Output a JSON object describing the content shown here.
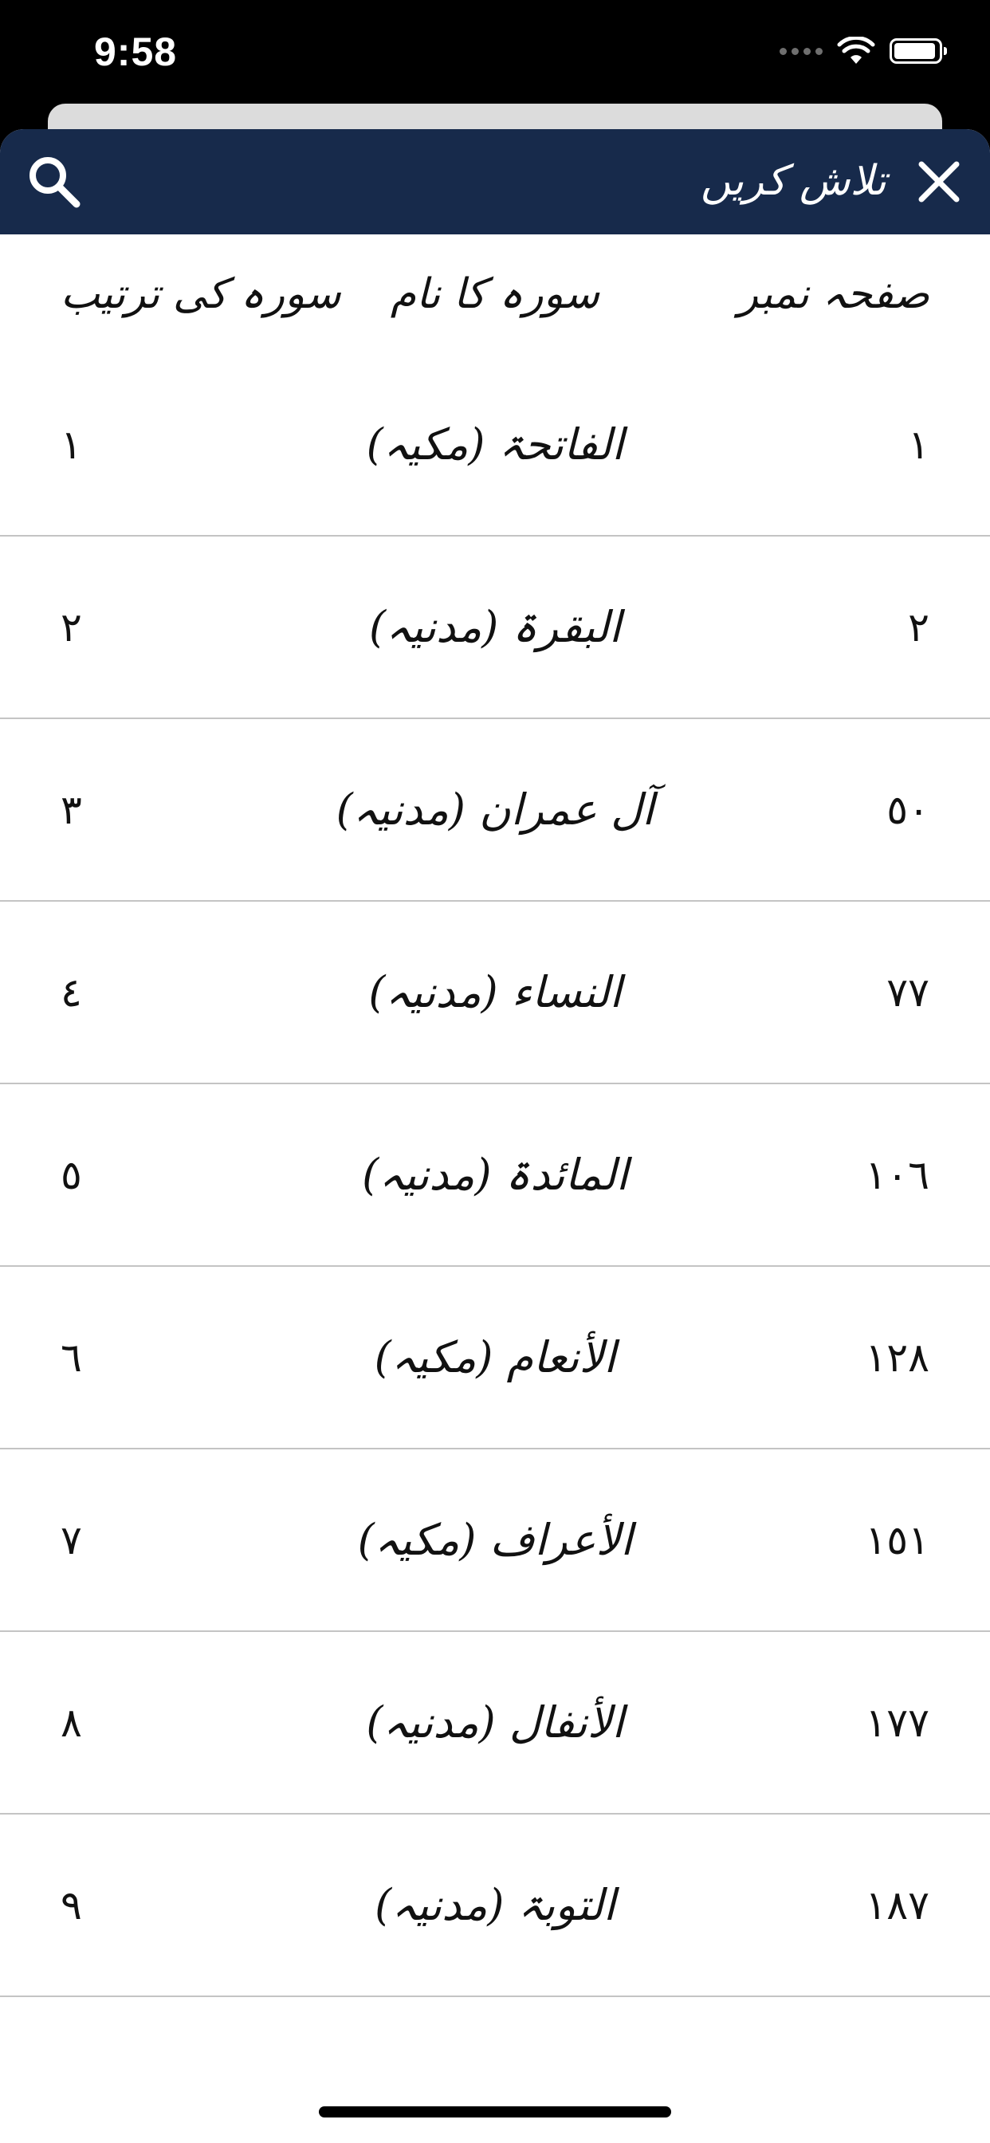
{
  "status_bar": {
    "time": "9:58",
    "battery_level": 0.95
  },
  "nav": {
    "title": "تلاش کریں",
    "search_icon": "search-icon",
    "close_icon": "close-icon",
    "bar_color": "#172a4b"
  },
  "table": {
    "headers": {
      "page": "صفحہ نمبر",
      "name": "سورہ کا نام",
      "order": "سورہ کی ترتیب"
    },
    "rows": [
      {
        "page": "١",
        "name": "الفاتحۃ (مکیہ)",
        "order": "١"
      },
      {
        "page": "٢",
        "name": "البقرۃ (مدنیہ)",
        "order": "٢"
      },
      {
        "page": "٥٠",
        "name": "آل عمران (مدنیہ)",
        "order": "٣"
      },
      {
        "page": "٧٧",
        "name": "النساء (مدنیہ)",
        "order": "٤"
      },
      {
        "page": "١٠٦",
        "name": "المائدۃ (مدنیہ)",
        "order": "٥"
      },
      {
        "page": "١٢٨",
        "name": "الأنعام (مکیہ)",
        "order": "٦"
      },
      {
        "page": "١٥١",
        "name": "الأعراف (مکیہ)",
        "order": "٧"
      },
      {
        "page": "١٧٧",
        "name": "الأنفال (مدنیہ)",
        "order": "٨"
      },
      {
        "page": "١٨٧",
        "name": "التوبۃ (مدنیہ)",
        "order": "٩"
      }
    ]
  }
}
